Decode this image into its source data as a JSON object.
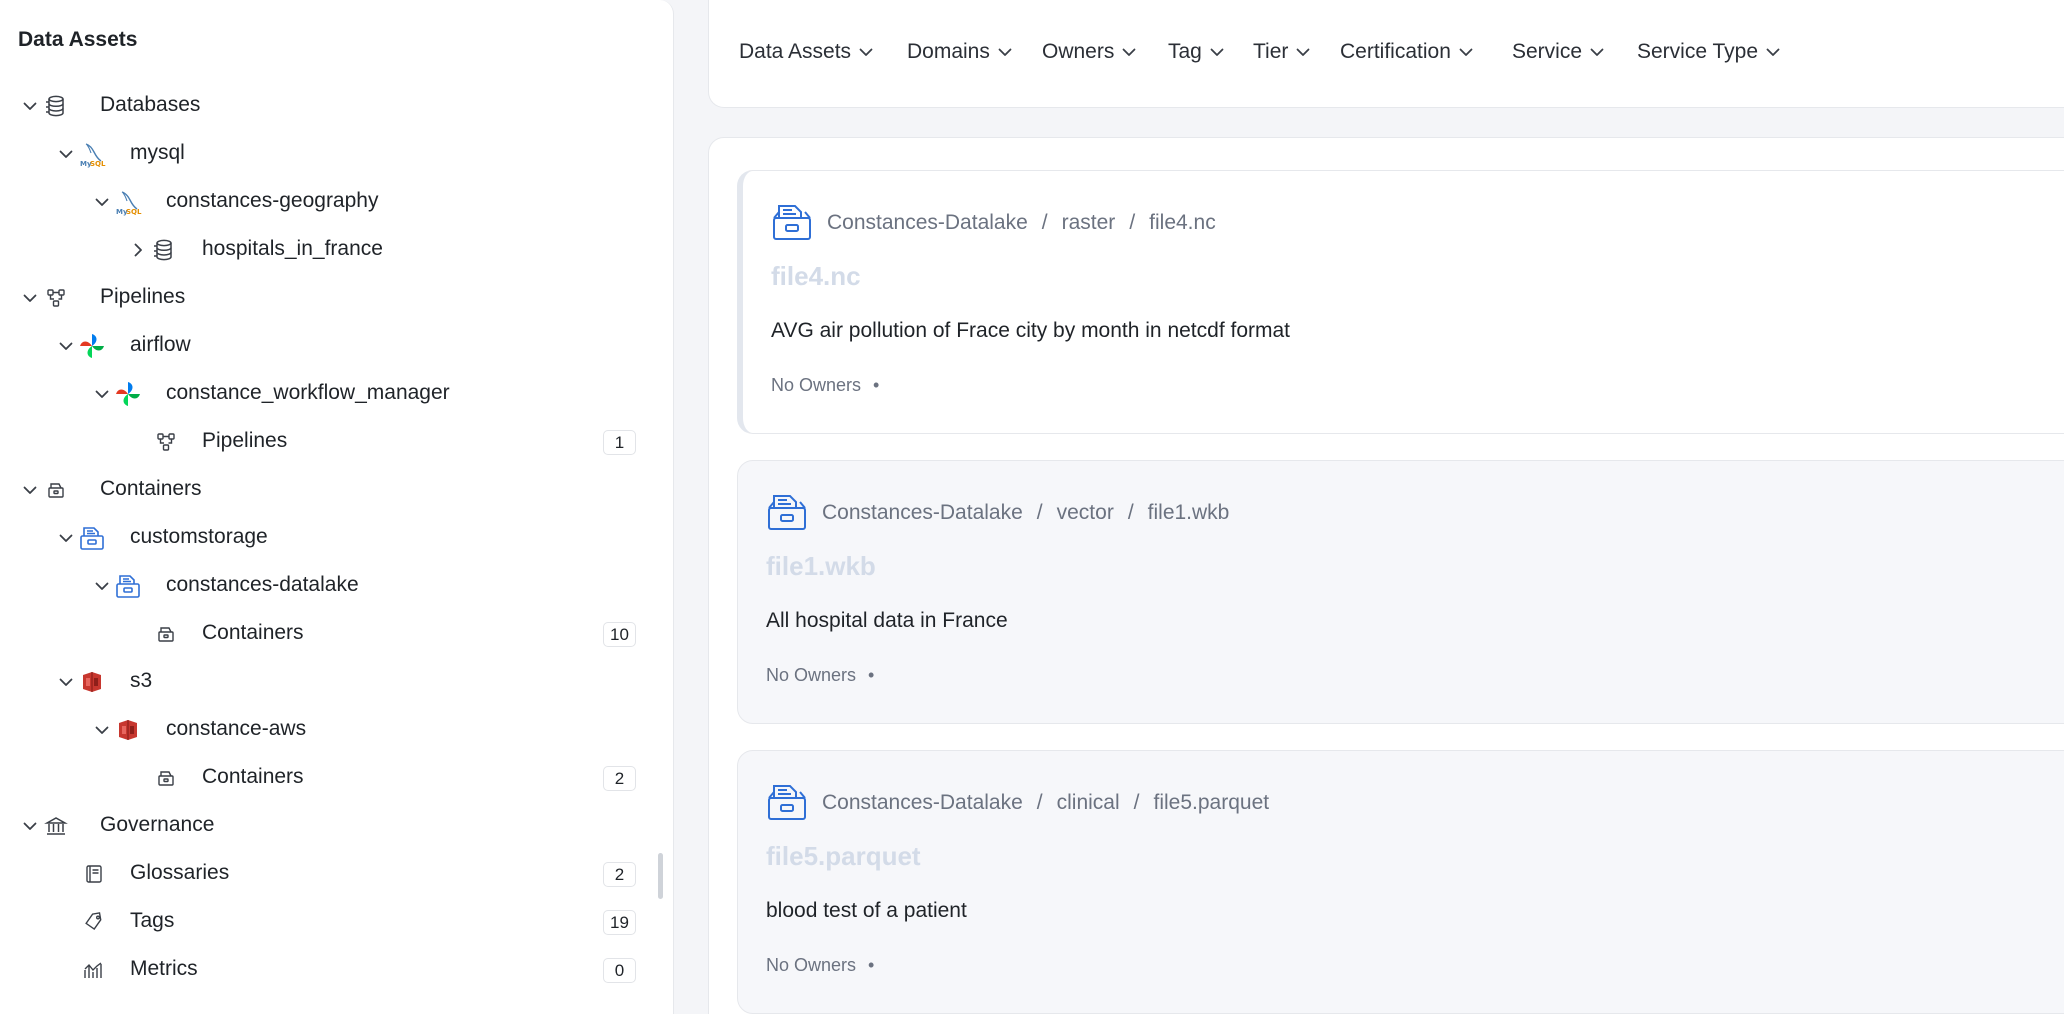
{
  "sidebar": {
    "title": "Data Assets",
    "items": [
      {
        "label": "Databases",
        "icon": "database-icon",
        "level": 0
      },
      {
        "label": "mysql",
        "icon": "mysql-icon",
        "level": 1
      },
      {
        "label": "constances-geography",
        "icon": "mysql-icon",
        "level": 2
      },
      {
        "label": "hospitals_in_france",
        "icon": "database-icon",
        "level": 3
      },
      {
        "label": "Pipelines",
        "icon": "pipeline-icon",
        "level": 0
      },
      {
        "label": "airflow",
        "icon": "airflow-icon",
        "level": 1
      },
      {
        "label": "constance_workflow_manager",
        "icon": "airflow-icon",
        "level": 2
      },
      {
        "label": "Pipelines",
        "icon": "pipeline-icon",
        "level": 3,
        "count": "1"
      },
      {
        "label": "Containers",
        "icon": "container-icon",
        "level": 0
      },
      {
        "label": "customstorage",
        "icon": "storage-icon",
        "level": 1
      },
      {
        "label": "constances-datalake",
        "icon": "storage-icon",
        "level": 2
      },
      {
        "label": "Containers",
        "icon": "container-icon",
        "level": 3,
        "count": "10"
      },
      {
        "label": "s3",
        "icon": "s3-icon",
        "level": 1
      },
      {
        "label": "constance-aws",
        "icon": "s3-icon",
        "level": 2
      },
      {
        "label": "Containers",
        "icon": "container-icon",
        "level": 3,
        "count": "2"
      },
      {
        "label": "Governance",
        "icon": "governance-icon",
        "level": 0
      },
      {
        "label": "Glossaries",
        "icon": "glossary-icon",
        "level": 1,
        "count": "2"
      },
      {
        "label": "Tags",
        "icon": "tag-icon",
        "level": 1,
        "count": "19"
      },
      {
        "label": "Metrics",
        "icon": "metrics-icon",
        "level": 1,
        "count": "0"
      }
    ]
  },
  "filters": [
    {
      "label": "Data Assets"
    },
    {
      "label": "Domains"
    },
    {
      "label": "Owners"
    },
    {
      "label": "Tag"
    },
    {
      "label": "Tier"
    },
    {
      "label": "Certification"
    },
    {
      "label": "Service"
    },
    {
      "label": "Service Type"
    }
  ],
  "results": [
    {
      "breadcrumb": [
        "Constances-Datalake",
        "raster",
        "file4.nc"
      ],
      "name": "file4.nc",
      "description": "AVG air pollution of Frace city by month in netcdf format",
      "owners": "No Owners",
      "selected": true
    },
    {
      "breadcrumb": [
        "Constances-Datalake",
        "vector",
        "file1.wkb"
      ],
      "name": "file1.wkb",
      "description": "All hospital data in France",
      "owners": "No Owners",
      "selected": false
    },
    {
      "breadcrumb": [
        "Constances-Datalake",
        "clinical",
        "file5.parquet"
      ],
      "name": "file5.parquet",
      "description": "blood test of a patient",
      "owners": "No Owners",
      "selected": false
    }
  ],
  "separator": "/",
  "owner_dot": "•",
  "colors": {
    "accent": "#2f6fd6",
    "name_muted": "#d3dbe8"
  }
}
